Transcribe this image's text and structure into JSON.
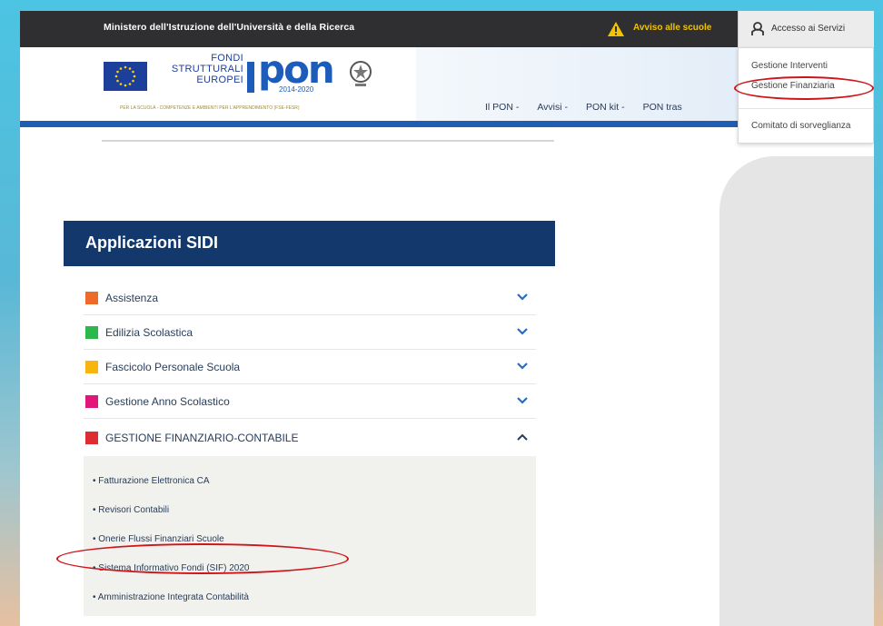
{
  "colors": {
    "topbar": "#2f2f31",
    "brand_blue": "#1d5cb8",
    "panel_header": "#12386c",
    "highlight_red": "#d0141b"
  },
  "topbar": {
    "ministry": "Ministero dell'Istruzione dell'Università e della Ricerca",
    "avviso": "Avviso alle scuole",
    "access_label": "Accesso ai Servizi",
    "warning_icon": "warning-triangle-icon",
    "user_icon": "user-icon"
  },
  "logo": {
    "fondi_lines": [
      "FONDI",
      "STRUTTURALI",
      "EUROPEI"
    ],
    "pon": "PON",
    "years": "2014-2020",
    "tagline": "PER LA SCUOLA - COMPETENZE E AMBIENTI PER L'APPRENDIMENTO (FSE-FESR)"
  },
  "nav": {
    "items": [
      "Il PON -",
      "Avvisi -",
      "PON kit -",
      "PON tras"
    ]
  },
  "dropdown": {
    "items": [
      "Gestione Interventi",
      "Gestione Finanziaria",
      "Comitato di sorveglianza"
    ]
  },
  "sidi": {
    "title": "Applicazioni SIDI",
    "rows": [
      {
        "label": "Assistenza",
        "color": "#ee6a2a",
        "chevron": "down"
      },
      {
        "label": "Edilizia Scolastica",
        "color": "#2db84c",
        "chevron": "down"
      },
      {
        "label": "Fascicolo Personale Scuola",
        "color": "#f6b60e",
        "chevron": "down"
      },
      {
        "label": "Gestione Anno Scolastico",
        "color": "#e2157a",
        "chevron": "down"
      },
      {
        "label": "GESTIONE FINANZIARIO-CONTABILE",
        "color": "#dd2d33",
        "chevron": "up"
      }
    ],
    "subitems": [
      "• Fatturazione Elettronica CA",
      "• Revisori Contabili",
      "• Onerie Flussi Finanziari Scuole",
      "• Sistema Informativo Fondi (SIF) 2020",
      "• Amministrazione Integrata Contabilità"
    ]
  }
}
